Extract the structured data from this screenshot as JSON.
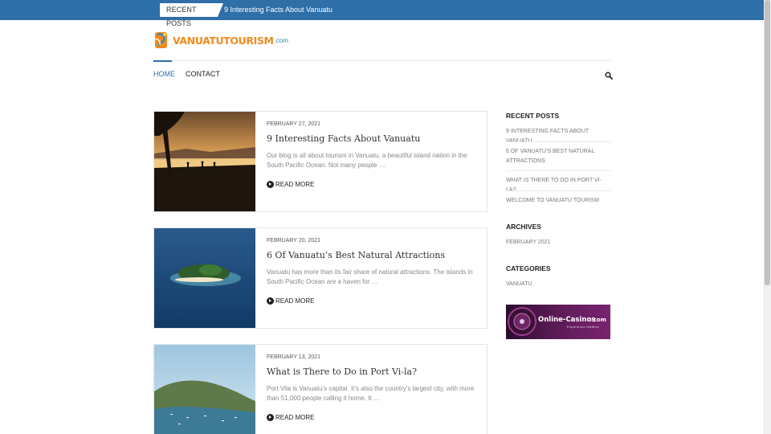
{
  "topbar": {
    "label": "RECENT POSTS",
    "ticker": "9 Interesting Facts About Vanuatu"
  },
  "logo": {
    "name": "VANUATUTOURISM",
    "tld": ".com"
  },
  "nav": {
    "items": [
      {
        "label": "HOME"
      },
      {
        "label": "CONTACT"
      }
    ]
  },
  "posts": [
    {
      "date": "FEBRUARY 27, 2021",
      "title": "9 Interesting Facts About Vanuatu",
      "excerpt": "Our blog is all about tourism in Vanuatu, a beautiful island nation in the South Pacific Ocean. Not many people …",
      "more": "READ MORE"
    },
    {
      "date": "FEBRUARY 20, 2021",
      "title": "6 Of Vanuatu’s Best Natural Attractions",
      "excerpt": "Vanuatu has more than its fair share of natural attractions. The islands in South Pacific Ocean are a haven for …",
      "more": "READ MORE"
    },
    {
      "date": "FEBRUARY 13, 2021",
      "title": "What is There to Do in Port Vi-la?",
      "excerpt": "Port Vila is Vanuatu’s capital. It’s also the country’s largest city, with more than 51,000 people calling it home. It …",
      "more": "READ MORE"
    }
  ],
  "sidebar": {
    "recent_heading": "RECENT POSTS",
    "recent": [
      "9 INTERESTING FACTS ABOUT VANUATU",
      "6 OF VANUATU’S BEST NATURAL ATTRACTIONS",
      "WHAT IS THERE TO DO IN PORT VI-LA?",
      "WELCOME TO VANUATU TOURISM"
    ],
    "archives_heading": "ARCHIVES",
    "archives": [
      "FEBRUARY 2021"
    ],
    "categories_heading": "CATEGORIES",
    "categories": [
      "VANUATU"
    ],
    "banner": {
      "brand": "Online-Casinos",
      "tld": ".com",
      "tagline": "Experience Matters"
    }
  },
  "colors": {
    "accent": "#2e6fa8",
    "logo_orange": "#f08a1c"
  }
}
